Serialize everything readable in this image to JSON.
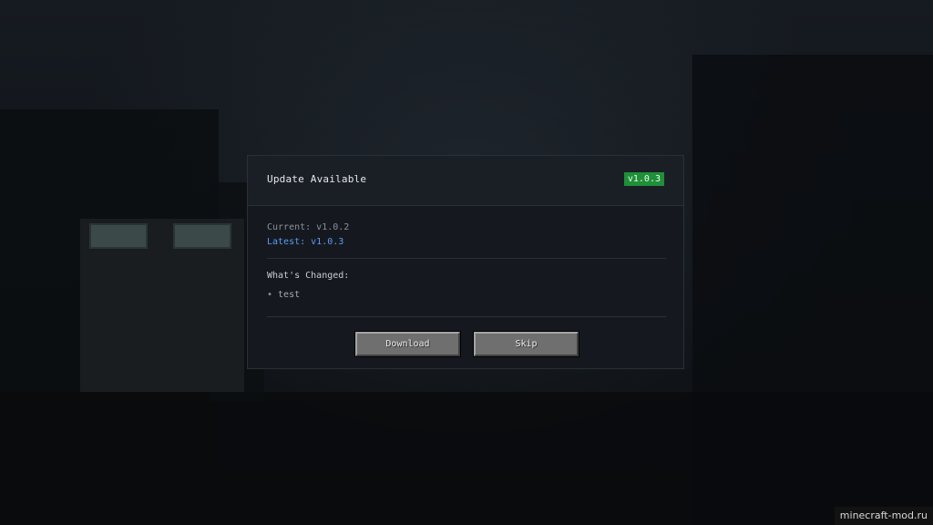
{
  "dialog": {
    "title": "Update Available",
    "badge": "v1.0.3",
    "current": "Current: v1.0.2",
    "latest": "Latest: v1.0.3",
    "changes_heading": "What's Changed:",
    "changes": [
      {
        "bullet": "•",
        "text": "test"
      }
    ],
    "download_label": "Download",
    "skip_label": "Skip"
  },
  "colors": {
    "badge_bg": "#1f8f3a",
    "latest_text": "#5b9cf0",
    "panel_bg": "#15191f",
    "button_bg": "#6f6f6f"
  }
}
